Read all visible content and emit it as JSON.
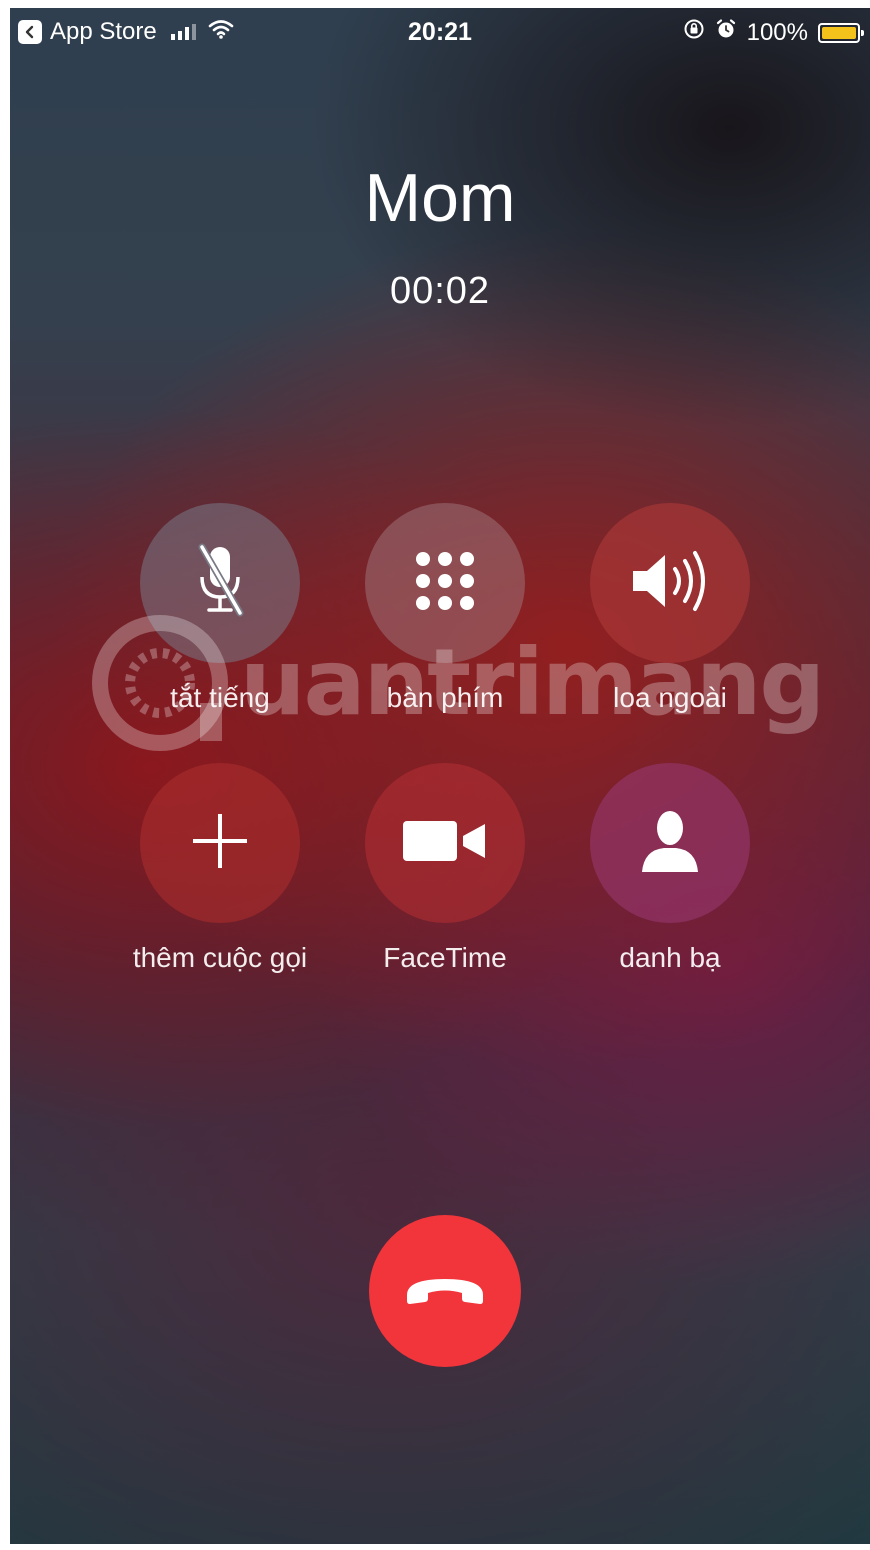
{
  "status_bar": {
    "back_app": "App Store",
    "time": "20:21",
    "battery_percent": "100%",
    "battery_level": 1.0,
    "battery_color": "#f3c21b"
  },
  "call": {
    "caller_name": "Mom",
    "duration": "00:02"
  },
  "controls": {
    "mute": "tắt tiếng",
    "keypad": "bàn phím",
    "speaker": "loa ngoài",
    "add_call": "thêm cuộc gọi",
    "facetime": "FaceTime",
    "contacts": "danh bạ"
  },
  "end_call": {
    "color": "#f2353b"
  },
  "watermark": {
    "text": "uantrimang"
  }
}
